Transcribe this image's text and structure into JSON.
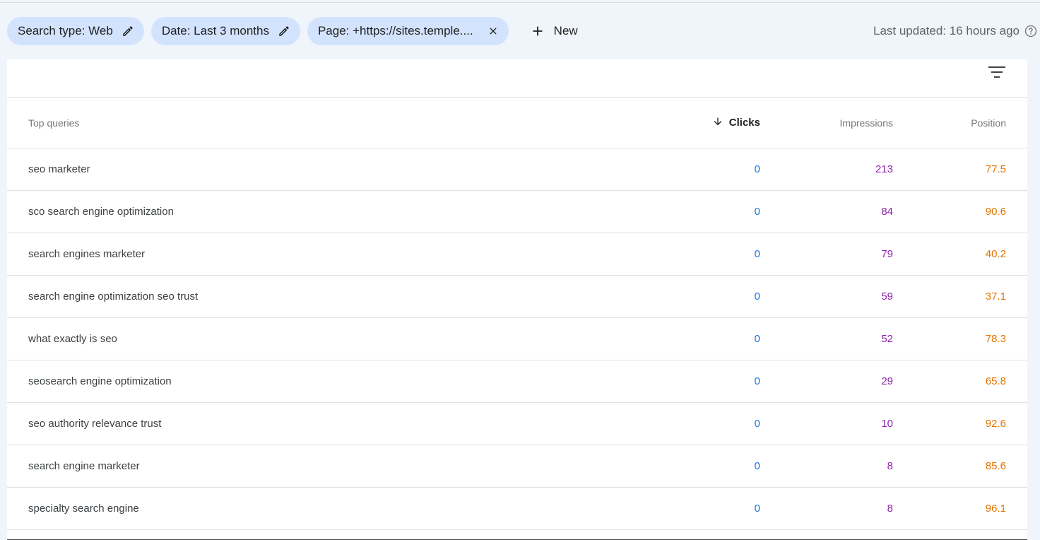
{
  "filters": {
    "chips": [
      {
        "label": "Search type: Web",
        "icon": "pencil-icon"
      },
      {
        "label": "Date: Last 3 months",
        "icon": "pencil-icon"
      },
      {
        "label": "Page: +https://sites.temple....",
        "icon": "close-icon"
      }
    ],
    "new_label": "New",
    "last_updated": "Last updated: 16 hours ago"
  },
  "table": {
    "headers": {
      "query": "Top queries",
      "clicks": "Clicks",
      "impressions": "Impressions",
      "position": "Position"
    },
    "rows": [
      {
        "query": "seo marketer",
        "clicks": "0",
        "impressions": "213",
        "position": "77.5"
      },
      {
        "query": "sco search engine optimization",
        "clicks": "0",
        "impressions": "84",
        "position": "90.6"
      },
      {
        "query": "search engines marketer",
        "clicks": "0",
        "impressions": "79",
        "position": "40.2"
      },
      {
        "query": "search engine optimization seo trust",
        "clicks": "0",
        "impressions": "59",
        "position": "37.1"
      },
      {
        "query": "what exactly is seo",
        "clicks": "0",
        "impressions": "52",
        "position": "78.3"
      },
      {
        "query": "seosearch engine optimization",
        "clicks": "0",
        "impressions": "29",
        "position": "65.8"
      },
      {
        "query": "seo authority relevance trust",
        "clicks": "0",
        "impressions": "10",
        "position": "92.6"
      },
      {
        "query": "search engine marketer",
        "clicks": "0",
        "impressions": "8",
        "position": "85.6"
      },
      {
        "query": "specialty search engine",
        "clicks": "0",
        "impressions": "8",
        "position": "96.1"
      }
    ]
  },
  "colors": {
    "clicks": "#1a73e8",
    "impressions": "#8e24aa",
    "position": "#e37400",
    "chip_bg": "#d3e3fd"
  }
}
